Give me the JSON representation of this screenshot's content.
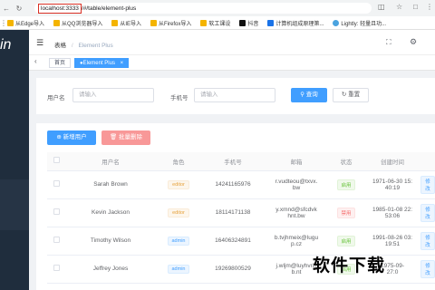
{
  "browser": {
    "url_host": "localhost:3333",
    "url_path": "/#/table/element-plus",
    "bookmarks": [
      {
        "label": "从Edge导入",
        "color": "#f4b400"
      },
      {
        "label": "从QQ浏览器导入",
        "color": "#f4b400"
      },
      {
        "label": "从IE导入",
        "color": "#f4b400"
      },
      {
        "label": "从Firefox导入",
        "color": "#f4b400"
      },
      {
        "label": "软工课设",
        "color": "#f4b400"
      },
      {
        "label": "抖音",
        "color": "#111111"
      },
      {
        "label": "计算机组成原理第...",
        "color": "#1a73e8"
      },
      {
        "label": "Lightly: 轻量且功...",
        "color": "#4aa3df"
      }
    ]
  },
  "sidebar": {
    "logo": "in"
  },
  "header": {
    "breadcrumb": [
      "表格",
      "Element Plus"
    ],
    "separator": "/"
  },
  "tags": [
    {
      "label": "首页",
      "active": false
    },
    {
      "label": "Element Plus",
      "active": true
    }
  ],
  "search": {
    "username_label": "用户名",
    "username_placeholder": "请输入",
    "phone_label": "手机号",
    "phone_placeholder": "请输入",
    "query_button": "查询",
    "reset_button": "重置"
  },
  "toolbar": {
    "add_button": "新增用户",
    "batch_delete_button": "批量删除"
  },
  "table": {
    "columns": [
      "用户名",
      "角色",
      "手机号",
      "邮箱",
      "状态",
      "创建时间"
    ],
    "rows": [
      {
        "name": "Sarah Brown",
        "role": "editor",
        "phone": "14241165976",
        "email1": "r.vudteou@txvx.",
        "email2": "bw",
        "status": "启用",
        "status_type": "ok",
        "date": "1971-06-30 15:",
        "time": "40:19",
        "action": "修改"
      },
      {
        "name": "Kevin Jackson",
        "role": "editor",
        "phone": "18114171138",
        "email1": "y.xmnd@sfcdvk",
        "email2": "hnt.bw",
        "status": "禁用",
        "status_type": "off",
        "date": "1985-01-08 22:",
        "time": "53:06",
        "action": "修改"
      },
      {
        "name": "Timothy Wilson",
        "role": "admin",
        "phone": "16406324891",
        "email1": "b.tvjhmeix@lugu",
        "email2": "p.cz",
        "status": "启用",
        "status_type": "ok",
        "date": "1991-08-26 03:",
        "time": "19:51",
        "action": "修改"
      },
      {
        "name": "Jeffrey Jones",
        "role": "admin",
        "phone": "19269800529",
        "email1": "j.wljm@luyhvris",
        "email2": "b.nt",
        "status": "启用",
        "status_type": "ok",
        "date": "1975-09-",
        "time": "27:0",
        "action": "修改"
      }
    ]
  },
  "watermark": "软件下载",
  "colors": {
    "primary": "#409eff",
    "danger": "#f89898",
    "sidebar": "#1f2d3d",
    "url_highlight": "#d93025"
  }
}
